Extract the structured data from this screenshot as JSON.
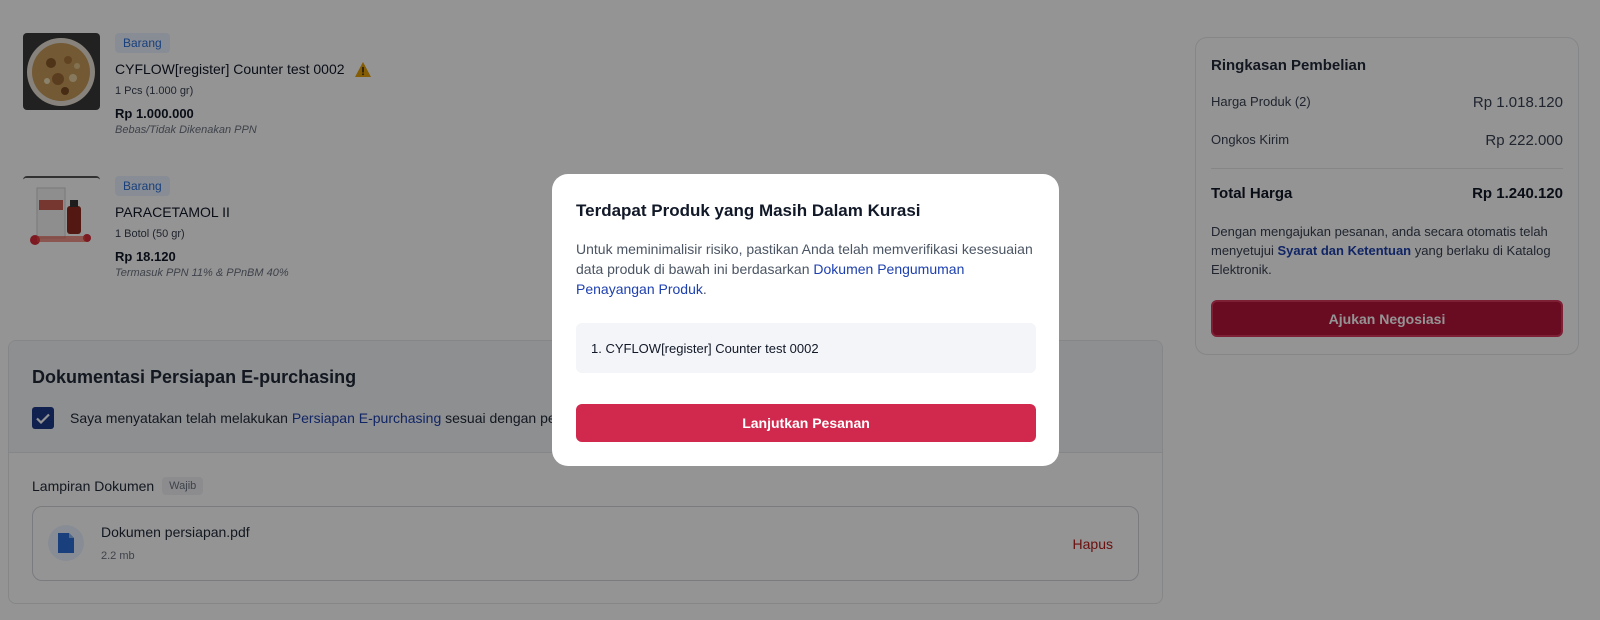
{
  "products": [
    {
      "tag": "Barang",
      "name": "CYFLOW[register] Counter test 0002",
      "qty": "1 Pcs (1.000 gr)",
      "price": "Rp 1.000.000",
      "tax": "Bebas/Tidak Dikenakan PPN",
      "warning_icon": "warning-icon"
    },
    {
      "tag": "Barang",
      "name": "PARACETAMOL II",
      "qty": "1 Botol (50 gr)",
      "price": "Rp 18.120",
      "tax": "Termasuk PPN 11% & PPnBM 40%"
    }
  ],
  "documentation": {
    "title": "Dokumentasi Persiapan E-purchasing",
    "checkbox_checked": true,
    "statement_prefix": "Saya menyatakan telah melakukan ",
    "statement_link": "Persiapan E-purchasing",
    "statement_suffix": " sesuai dengan pe",
    "attachment_label": "Lampiran Dokumen",
    "attachment_badge": "Wajib",
    "file": {
      "name": "Dokumen persiapan.pdf",
      "size": "2.2 mb",
      "delete_label": "Hapus",
      "icon": "file-icon"
    }
  },
  "summary": {
    "title": "Ringkasan Pembelian",
    "rows": [
      {
        "label": "Harga Produk (2)",
        "value": "Rp 1.018.120"
      },
      {
        "label": "Ongkos Kirim",
        "value": "Rp 222.000"
      }
    ],
    "total_label": "Total Harga",
    "total_value": "Rp 1.240.120",
    "note_prefix": "Dengan mengajukan pesanan, anda secara otomatis telah menyetujui ",
    "note_link": "Syarat dan Ketentuan",
    "note_suffix": " yang berlaku di Katalog Elektronik.",
    "button_label": "Ajukan Negosiasi"
  },
  "modal": {
    "title": "Terdapat Produk yang Masih Dalam Kurasi",
    "description_prefix": "Untuk meminimalisir risiko, pastikan Anda telah memverifikasi kesesuaian data produk di bawah ini berdasarkan ",
    "description_link": "Dokumen Pengumuman Penayangan Produk",
    "description_suffix": ".",
    "items": [
      "1. CYFLOW[register] Counter test 0002"
    ],
    "button_label": "Lanjutkan Pesanan"
  },
  "colors": {
    "primary": "#d1294d",
    "link": "#1e40af",
    "checkbox": "#1d3a8a"
  }
}
